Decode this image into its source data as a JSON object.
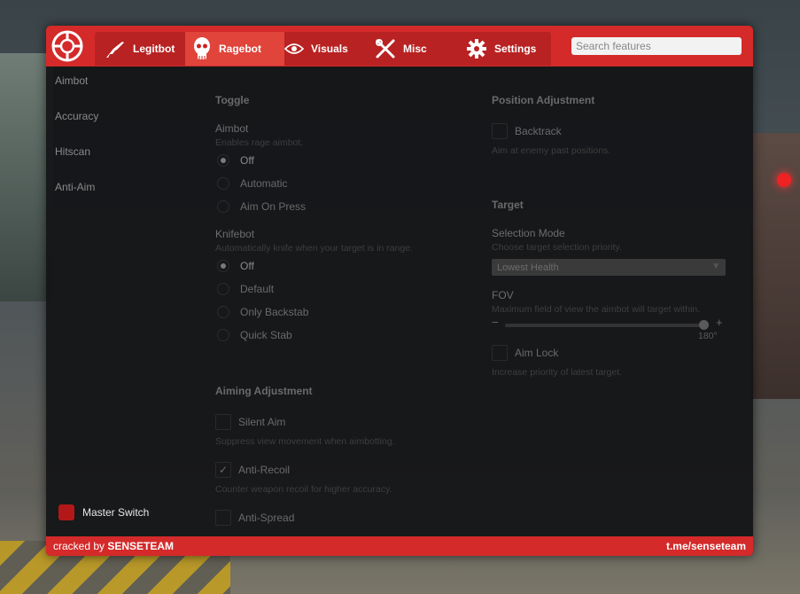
{
  "header": {
    "tabs": [
      {
        "label": "Legitbot",
        "icon": "rifle-icon"
      },
      {
        "label": "Ragebot",
        "icon": "skull-icon",
        "active": true
      },
      {
        "label": "Visuals",
        "icon": "eye-icon"
      },
      {
        "label": "Misc",
        "icon": "wrench-screwdriver-icon"
      },
      {
        "label": "Settings",
        "icon": "gear-icon"
      }
    ],
    "search_placeholder": "Search features"
  },
  "sidebar": {
    "items": [
      {
        "label": "Aimbot"
      },
      {
        "label": "Accuracy"
      },
      {
        "label": "Hitscan"
      },
      {
        "label": "Anti-Aim"
      }
    ],
    "master_switch": {
      "label": "Master Switch",
      "color": "#b21818"
    }
  },
  "toggle": {
    "title": "Toggle",
    "aimbot": {
      "label": "Aimbot",
      "desc": "Enables rage aimbot.",
      "options": [
        "Off",
        "Automatic",
        "Aim On Press"
      ],
      "selected": "Off"
    },
    "knifebot": {
      "label": "Knifebot",
      "desc": "Automatically knife when your target is in range.",
      "options": [
        "Off",
        "Default",
        "Only Backstab",
        "Quick Stab"
      ],
      "selected": "Off"
    }
  },
  "aiming": {
    "title": "Aiming Adjustment",
    "silent_aim": {
      "label": "Silent Aim",
      "desc": "Suppress view movement when aimbotting.",
      "checked": false
    },
    "anti_recoil": {
      "label": "Anti-Recoil",
      "desc": "Counter weapon recoil for higher accuracy.",
      "checked": true
    },
    "anti_spread": {
      "label": "Anti-Spread",
      "checked": false
    }
  },
  "position": {
    "title": "Position Adjustment",
    "backtrack": {
      "label": "Backtrack",
      "desc": "Aim at enemy past positions.",
      "checked": false
    }
  },
  "target": {
    "title": "Target",
    "selection_mode": {
      "label": "Selection Mode",
      "desc": "Choose target selection priority.",
      "value": "Lowest Health"
    },
    "fov": {
      "label": "FOV",
      "desc": "Maximum field of view the aimbot will target within.",
      "value_label": "180°",
      "fraction": 1.0
    },
    "aim_lock": {
      "label": "Aim Lock",
      "desc": "Increase priority of latest target.",
      "checked": false
    }
  },
  "footer": {
    "prefix": "cracked by ",
    "brand": "SENSETEAM",
    "link": "t.me/senseteam"
  },
  "colors": {
    "accent": "#d42a2a",
    "tab_active": "#e0443a",
    "panel": "#121315"
  }
}
